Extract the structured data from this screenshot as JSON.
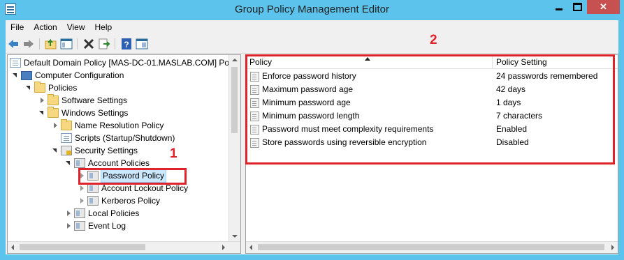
{
  "window": {
    "title": "Group Policy Management Editor"
  },
  "menu": [
    "File",
    "Action",
    "View",
    "Help"
  ],
  "toolbar_icons": [
    "back-arrow-icon",
    "forward-arrow-icon",
    "up-folder-icon",
    "show-hide-tree-icon",
    "delete-icon",
    "export-list-icon",
    "help-icon",
    "properties-icon"
  ],
  "tree": {
    "root": "Default Domain Policy [MAS-DC-01.MASLAB.COM] Policy",
    "computer_configuration": "Computer Configuration",
    "policies": "Policies",
    "software_settings": "Software Settings",
    "windows_settings": "Windows Settings",
    "name_resolution_policy": "Name Resolution Policy",
    "scripts": "Scripts (Startup/Shutdown)",
    "security_settings": "Security Settings",
    "account_policies": "Account Policies",
    "password_policy": "Password Policy",
    "account_lockout_policy": "Account Lockout Policy",
    "kerberos_policy": "Kerberos Policy",
    "local_policies": "Local Policies",
    "event_log": "Event Log"
  },
  "list": {
    "columns": {
      "policy": "Policy",
      "setting": "Policy Setting"
    },
    "rows": [
      {
        "policy": "Enforce password history",
        "setting": "24 passwords remembered"
      },
      {
        "policy": "Maximum password age",
        "setting": "42 days"
      },
      {
        "policy": "Minimum password age",
        "setting": "1 days"
      },
      {
        "policy": "Minimum password length",
        "setting": "7 characters"
      },
      {
        "policy": "Password must meet complexity requirements",
        "setting": "Enabled"
      },
      {
        "policy": "Store passwords using reversible encryption",
        "setting": "Disabled"
      }
    ]
  },
  "annotations": {
    "label1": "1",
    "label2": "2"
  },
  "colors": {
    "titlebar": "#5bc3ec",
    "annotation": "#e0222b",
    "close_button": "#c75050"
  }
}
